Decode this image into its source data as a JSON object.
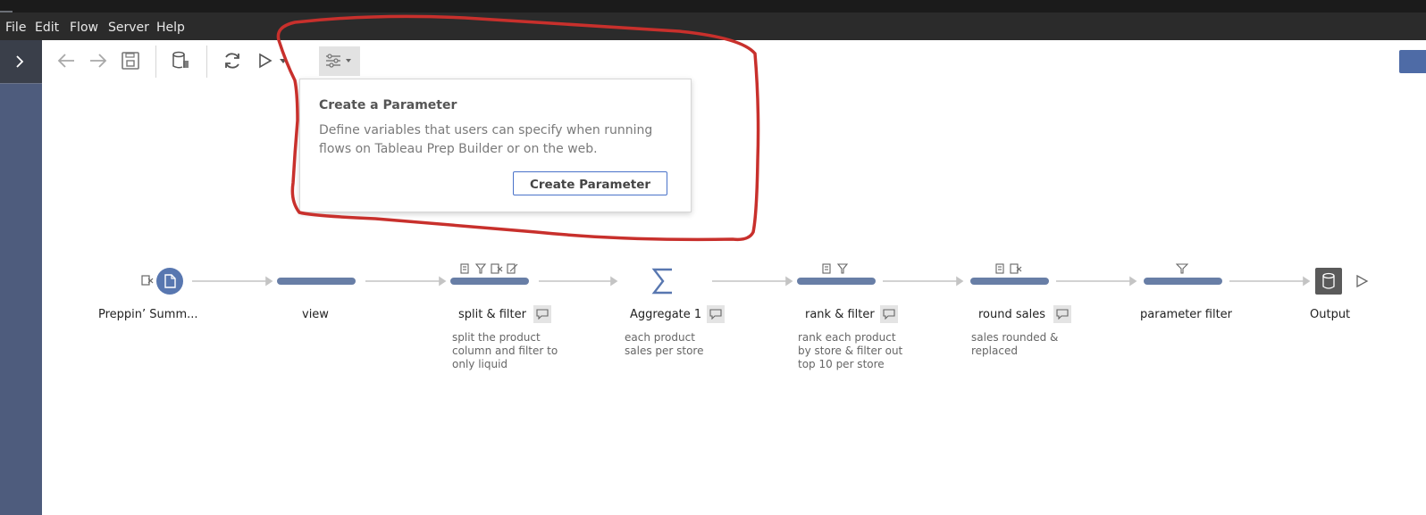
{
  "menu": {
    "file": "File",
    "edit": "Edit",
    "flow": "Flow",
    "server": "Server",
    "help": "Help"
  },
  "toolbar": {
    "icons": [
      "chevron-right-icon",
      "back-arrow-icon",
      "forward-arrow-icon",
      "save-icon",
      "data-pause-icon",
      "refresh-icon",
      "run-icon",
      "dropdown-icon",
      "parameters-icon",
      "dropdown-icon"
    ],
    "accent": "#4e6ba6"
  },
  "popup": {
    "title": "Create a Parameter",
    "description": "Define variables that users can specify when running flows on Tableau Prep Builder or on the web.",
    "button": "Create Parameter"
  },
  "flow": {
    "steps": [
      {
        "label": "Preppin’ Summ...",
        "desc": "",
        "type": "input"
      },
      {
        "label": "view",
        "desc": "",
        "type": "clean"
      },
      {
        "label": "split & filter",
        "desc": "split the product column and filter to only liquid",
        "type": "clean"
      },
      {
        "label": "Aggregate 1",
        "desc": "each product sales per store",
        "type": "aggregate"
      },
      {
        "label": "rank & filter",
        "desc": "rank each product by store & filter out top 10 per store",
        "type": "clean"
      },
      {
        "label": "round sales",
        "desc": "sales rounded & replaced",
        "type": "clean"
      },
      {
        "label": "parameter filter",
        "desc": "",
        "type": "clean"
      },
      {
        "label": "Output",
        "desc": "",
        "type": "output"
      }
    ]
  },
  "colors": {
    "node": "#687ea6",
    "sidebar": "#4e5c7d",
    "annotation": "#c8302c"
  }
}
